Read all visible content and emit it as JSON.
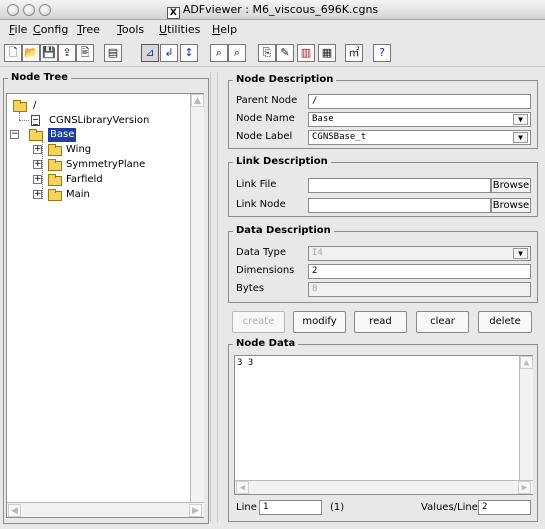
{
  "window": {
    "title": "ADFviewer : M6_viscous_696K.cgns",
    "logo_letter": "X"
  },
  "menu": [
    "File",
    "Config",
    "Tree",
    "Tools",
    "Utilities",
    "Help"
  ],
  "toolbar": {
    "buttons": [
      {
        "name": "new-file-icon",
        "glyph": "🗋"
      },
      {
        "name": "open-folder-icon",
        "glyph": "📂"
      },
      {
        "name": "save-icon",
        "glyph": "💾"
      },
      {
        "name": "save-as-icon",
        "glyph": "⇪"
      },
      {
        "name": "file-info-icon",
        "glyph": "🖹"
      },
      {
        "name": "print-icon",
        "glyph": "▤"
      },
      {
        "name": "tree-expand-icon",
        "glyph": "⊿"
      },
      {
        "name": "tree-collapse-icon",
        "glyph": "↲"
      },
      {
        "name": "tree-level-icon",
        "glyph": "↕"
      },
      {
        "name": "search-icon",
        "glyph": "⌕"
      },
      {
        "name": "search-next-icon",
        "glyph": "⌕"
      },
      {
        "name": "copy-node-icon",
        "glyph": "⎘"
      },
      {
        "name": "edit-node-icon",
        "glyph": "✎"
      },
      {
        "name": "plot-icon",
        "glyph": "▥"
      },
      {
        "name": "calculator-icon",
        "glyph": "▦"
      },
      {
        "name": "units-icon",
        "glyph": "㎡"
      },
      {
        "name": "help-icon",
        "glyph": "?"
      }
    ]
  },
  "tree_panel": {
    "title": "Node Tree",
    "nodes": [
      {
        "label": "/",
        "level": 0,
        "icon": "folder",
        "expander": ""
      },
      {
        "label": "CGNSLibraryVersion",
        "level": 1,
        "icon": "document",
        "expander": ""
      },
      {
        "label": "Base",
        "level": 0,
        "icon": "folder",
        "expander": "−",
        "selected": true
      },
      {
        "label": "Wing",
        "level": 1,
        "icon": "folder",
        "expander": "+"
      },
      {
        "label": "SymmetryPlane",
        "level": 1,
        "icon": "folder",
        "expander": "+"
      },
      {
        "label": "Farfield",
        "level": 1,
        "icon": "folder",
        "expander": "+"
      },
      {
        "label": "Main",
        "level": 1,
        "icon": "folder",
        "expander": "+"
      }
    ]
  },
  "node_description": {
    "title": "Node Description",
    "parent_node_label": "Parent Node",
    "parent_node_value": "/",
    "node_name_label": "Node Name",
    "node_name_value": "Base",
    "node_label_label": "Node Label",
    "node_label_value": "CGNSBase_t"
  },
  "link_description": {
    "title": "Link Description",
    "link_file_label": "Link File",
    "link_file_value": "",
    "link_node_label": "Link Node",
    "link_node_value": "",
    "browse_label": "Browse"
  },
  "data_description": {
    "title": "Data Description",
    "data_type_label": "Data Type",
    "data_type_value": "I4",
    "dimensions_label": "Dimensions",
    "dimensions_value": "2",
    "bytes_label": "Bytes",
    "bytes_value": "8"
  },
  "actions": {
    "create": "create",
    "modify": "modify",
    "read": "read",
    "clear": "clear",
    "delete": "delete"
  },
  "node_data": {
    "title": "Node Data",
    "content": "3 3",
    "line_label": "Line",
    "line_value": "1",
    "line_count": "(1)",
    "values_per_line_label": "Values/Line",
    "values_per_line_value": "2"
  }
}
